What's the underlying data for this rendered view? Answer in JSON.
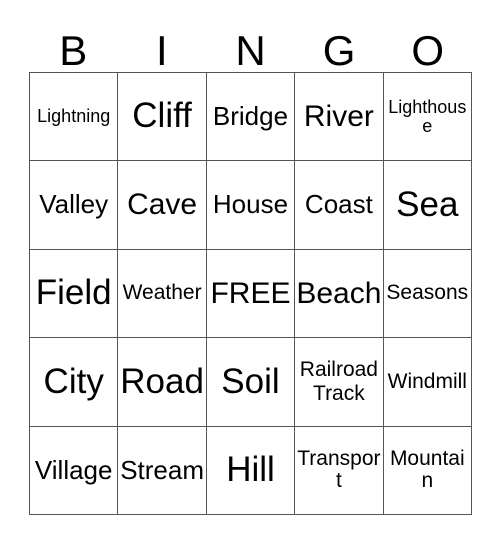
{
  "card": {
    "header_letters": [
      "B",
      "I",
      "N",
      "G",
      "O"
    ],
    "rows": [
      [
        {
          "label": "Lightning",
          "size": "xs"
        },
        {
          "label": "Cliff",
          "size": "xl"
        },
        {
          "label": "Bridge",
          "size": "md"
        },
        {
          "label": "River",
          "size": "lg"
        },
        {
          "label": "Lighthouse",
          "size": "xs"
        }
      ],
      [
        {
          "label": "Valley",
          "size": "md"
        },
        {
          "label": "Cave",
          "size": "lg"
        },
        {
          "label": "House",
          "size": "md"
        },
        {
          "label": "Coast",
          "size": "md"
        },
        {
          "label": "Sea",
          "size": "xl"
        }
      ],
      [
        {
          "label": "Field",
          "size": "xl"
        },
        {
          "label": "Weather",
          "size": "sm"
        },
        {
          "label": "FREE",
          "size": "lg"
        },
        {
          "label": "Beach",
          "size": "lg"
        },
        {
          "label": "Seasons",
          "size": "sm"
        }
      ],
      [
        {
          "label": "City",
          "size": "xl"
        },
        {
          "label": "Road",
          "size": "xl"
        },
        {
          "label": "Soil",
          "size": "xl"
        },
        {
          "label": "Railroad Track",
          "size": "two-line"
        },
        {
          "label": "Windmill",
          "size": "sm"
        }
      ],
      [
        {
          "label": "Village",
          "size": "md"
        },
        {
          "label": "Stream",
          "size": "md"
        },
        {
          "label": "Hill",
          "size": "xl"
        },
        {
          "label": "Transport",
          "size": "sm"
        },
        {
          "label": "Mountain",
          "size": "sm"
        }
      ]
    ],
    "free_space": "FREE",
    "colors": {
      "background": "#ffffff",
      "text": "#000000",
      "grid_line": "#555555"
    }
  }
}
